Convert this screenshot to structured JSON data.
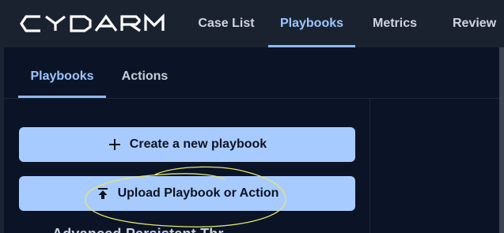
{
  "app": {
    "logo_text": "CYDARM"
  },
  "topnav": {
    "tabs": [
      {
        "label": "Case List",
        "active": false
      },
      {
        "label": "Playbooks",
        "active": true
      },
      {
        "label": "Metrics",
        "active": false
      },
      {
        "label": "Review",
        "active": false
      }
    ]
  },
  "subnav": {
    "tabs": [
      {
        "label": "Playbooks",
        "active": true
      },
      {
        "label": "Actions",
        "active": false
      }
    ]
  },
  "main": {
    "create_button": {
      "label": "Create a new playbook",
      "icon": "plus-icon"
    },
    "upload_button": {
      "label": "Upload Playbook or Action",
      "icon": "upload-icon"
    },
    "partial_heading": "Advanced Persistent Thr..."
  },
  "colors": {
    "background": "#0a1426",
    "topbar": "#1a2230",
    "accent": "#9cc5ff",
    "button_bg": "#a8cbff",
    "annotation": "#e7e76a"
  }
}
